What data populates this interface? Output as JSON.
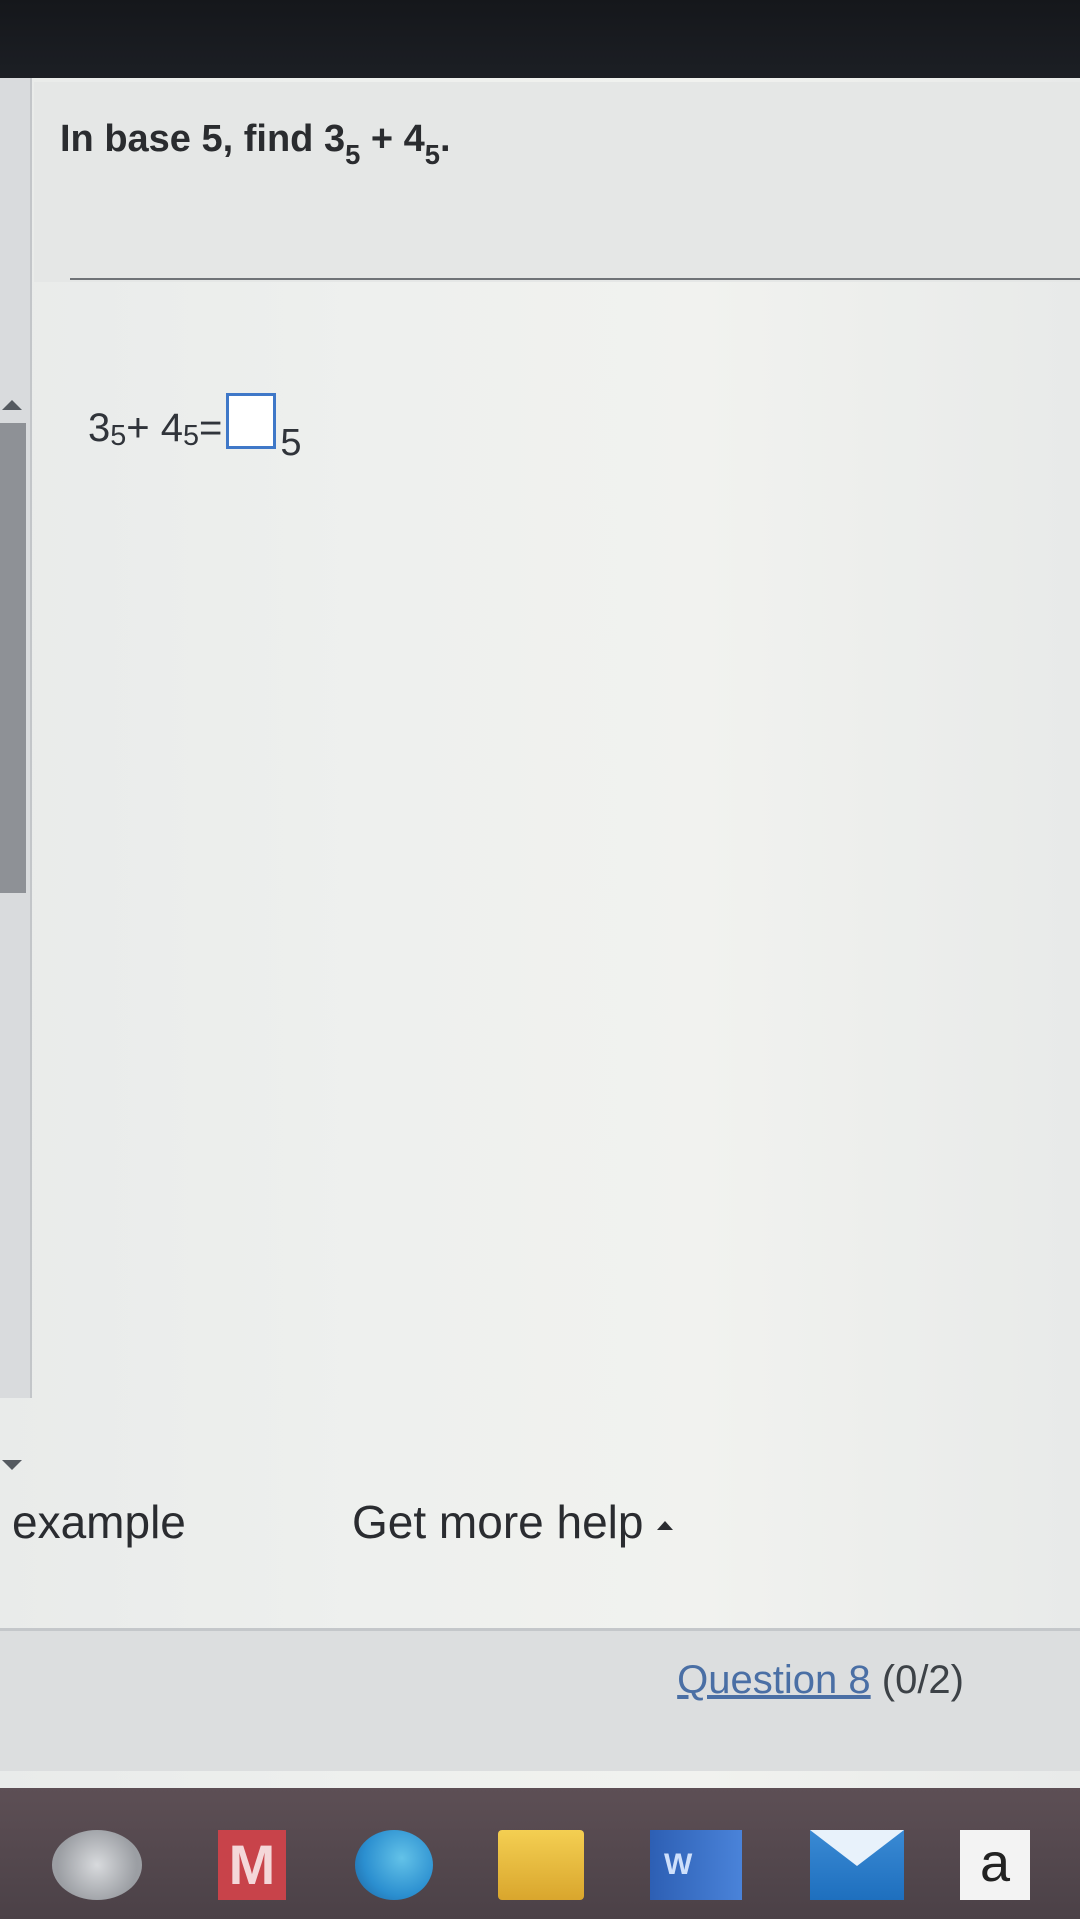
{
  "question": {
    "prefix": "In base 5, find 3",
    "sub_a": "5",
    "plus": " + 4",
    "sub_b": "5",
    "suffix": "."
  },
  "equation": {
    "a": "3",
    "a_base": "5",
    "plus": " + 4",
    "b_base": "5",
    "equals": " = ",
    "answer_value": "",
    "result_base": "5"
  },
  "help": {
    "example_label": "example",
    "more_help_label": "Get more help"
  },
  "navigation": {
    "question_link": "Question 8",
    "score": " (0/2)"
  },
  "taskbar": {
    "icons": [
      "chrome-icon",
      "mcafee-icon",
      "edge-icon",
      "file-explorer-icon",
      "word-icon",
      "mail-icon",
      "amazon-icon"
    ],
    "mcafee_letter": "M",
    "word_letter": "W",
    "amazon_letter": "a"
  },
  "colors": {
    "answer_box_border": "#3f78c8",
    "link": "#4a6fa5"
  }
}
